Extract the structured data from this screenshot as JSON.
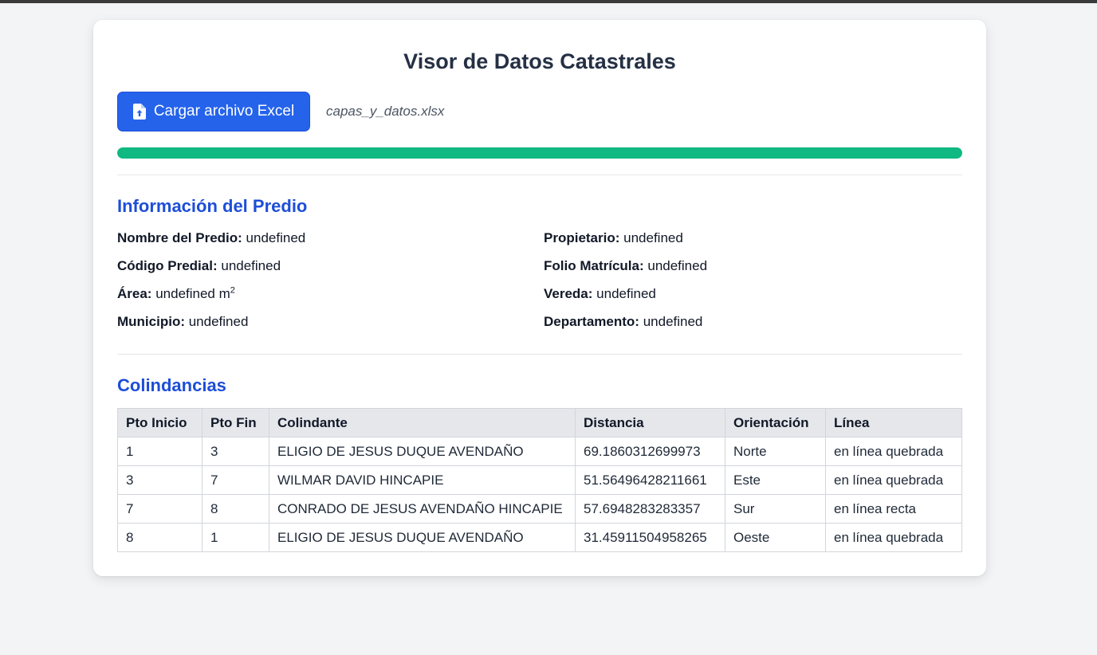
{
  "title": "Visor de Datos Catastrales",
  "upload": {
    "button_label": "Cargar archivo Excel",
    "file_name": "capas_y_datos.xlsx",
    "progress": 1.0
  },
  "predio": {
    "section_title": "Información del Predio",
    "fields": [
      {
        "label": "Nombre del Predio:",
        "value": "undefined"
      },
      {
        "label": "Propietario:",
        "value": "undefined"
      },
      {
        "label": "Código Predial:",
        "value": "undefined"
      },
      {
        "label": "Folio Matrícula:",
        "value": "undefined"
      },
      {
        "label": "Área:",
        "value": "undefined m",
        "unit_sup": "2"
      },
      {
        "label": "Vereda:",
        "value": "undefined"
      },
      {
        "label": "Municipio:",
        "value": "undefined"
      },
      {
        "label": "Departamento:",
        "value": "undefined"
      }
    ]
  },
  "colindancias": {
    "section_title": "Colindancias",
    "headers": [
      "Pto Inicio",
      "Pto Fin",
      "Colindante",
      "Distancia",
      "Orientación",
      "Línea"
    ],
    "rows": [
      [
        "1",
        "3",
        "ELIGIO DE JESUS DUQUE AVENDAÑO",
        "69.1860312699973",
        "Norte",
        "en línea quebrada"
      ],
      [
        "3",
        "7",
        "WILMAR DAVID HINCAPIE",
        "51.56496428211661",
        "Este",
        "en línea quebrada"
      ],
      [
        "7",
        "8",
        "CONRADO DE JESUS AVENDAÑO HINCAPIE",
        "57.6948283283357",
        "Sur",
        "en línea recta"
      ],
      [
        "8",
        "1",
        "ELIGIO DE JESUS DUQUE AVENDAÑO",
        "31.45911504958265",
        "Oeste",
        "en línea quebrada"
      ]
    ]
  },
  "colors": {
    "accent": "#2563eb",
    "section_title": "#1d4ed8",
    "progress": "#10b981"
  }
}
